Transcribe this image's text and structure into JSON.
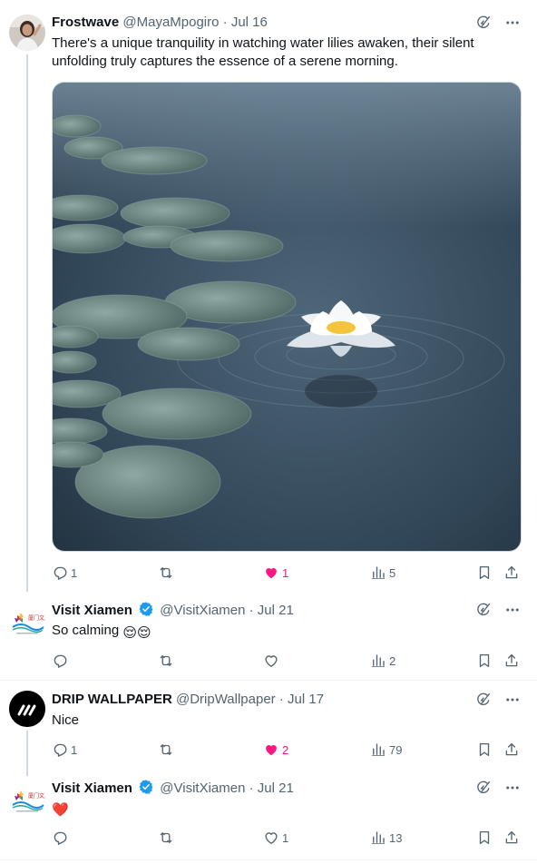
{
  "posts": [
    {
      "name": "Frostwave",
      "handle": "@MayaMpogiro",
      "sep": "·",
      "date": "Jul 16",
      "text": "There's a unique tranquility in watching water lilies awaken, their silent unfolding truly captures the essence of a serene morning.",
      "replies": "1",
      "reposts": "",
      "likes": "1",
      "views": "5",
      "liked": true
    },
    {
      "name": "Visit Xiamen",
      "handle": "@VisitXiamen",
      "sep": "·",
      "date": "Jul 21",
      "text": "So calming",
      "text_emoji": "😌😌",
      "replies": "",
      "reposts": "",
      "likes": "",
      "views": "2",
      "verified": true
    },
    {
      "name": "DRIP WALLPAPER",
      "handle": "@DripWallpaper",
      "sep": "·",
      "date": "Jul 17",
      "text": "Nice",
      "replies": "1",
      "reposts": "",
      "likes": "2",
      "views": "79",
      "liked": true
    },
    {
      "name": "Visit Xiamen",
      "handle": "@VisitXiamen",
      "sep": "·",
      "date": "Jul 21",
      "text": "❤️",
      "replies": "",
      "reposts": "",
      "likes": "1",
      "views": "13",
      "verified": true
    }
  ],
  "colors": {
    "text": "#0f1419",
    "secondary": "#536471",
    "like": "#f91880",
    "verified": "#1d9bf0",
    "divider": "#eff3f4"
  },
  "icons": [
    "grok-icon",
    "more-icon",
    "reply-icon",
    "repost-icon",
    "like-icon",
    "views-icon",
    "bookmark-icon",
    "share-icon",
    "verified-icon"
  ]
}
